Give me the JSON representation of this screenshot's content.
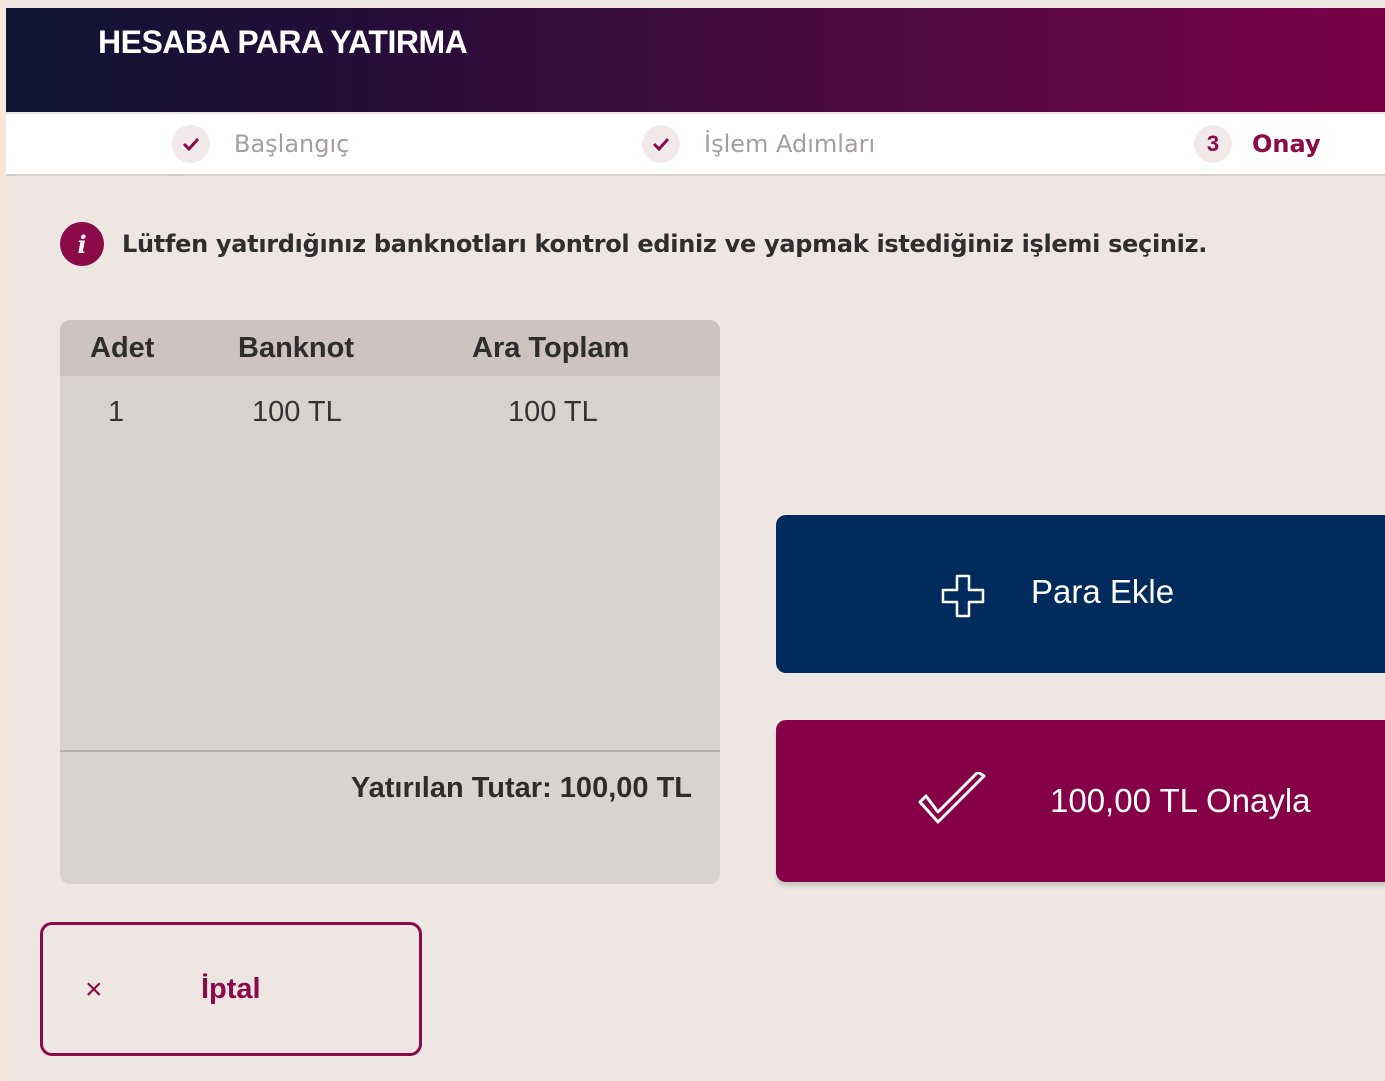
{
  "header": {
    "title": "HESABA PARA YATIRMA"
  },
  "stepper": {
    "steps": [
      {
        "label": "Başlangıç",
        "marker": "check-icon"
      },
      {
        "label": "İşlem Adımları",
        "marker": "check-icon"
      },
      {
        "label": "Onay",
        "marker": "3"
      }
    ]
  },
  "info": {
    "text": "Lütfen yatırdığınız banknotları kontrol ediniz ve yapmak istediğiniz işlemi seçiniz."
  },
  "table": {
    "columns": [
      "Adet",
      "Banknot",
      "Ara Toplam"
    ],
    "rows": [
      {
        "count": "1",
        "banknote": "100 TL",
        "subtotal": "100 TL"
      }
    ],
    "total": "Yatırılan Tutar: 100,00 TL"
  },
  "actions": {
    "add_label": "Para Ekle",
    "confirm_label": "100,00 TL Onayla",
    "cancel_label": "İptal",
    "cancel_icon": "×"
  },
  "colors": {
    "accent": "#850046",
    "primary": "#002b5c"
  }
}
